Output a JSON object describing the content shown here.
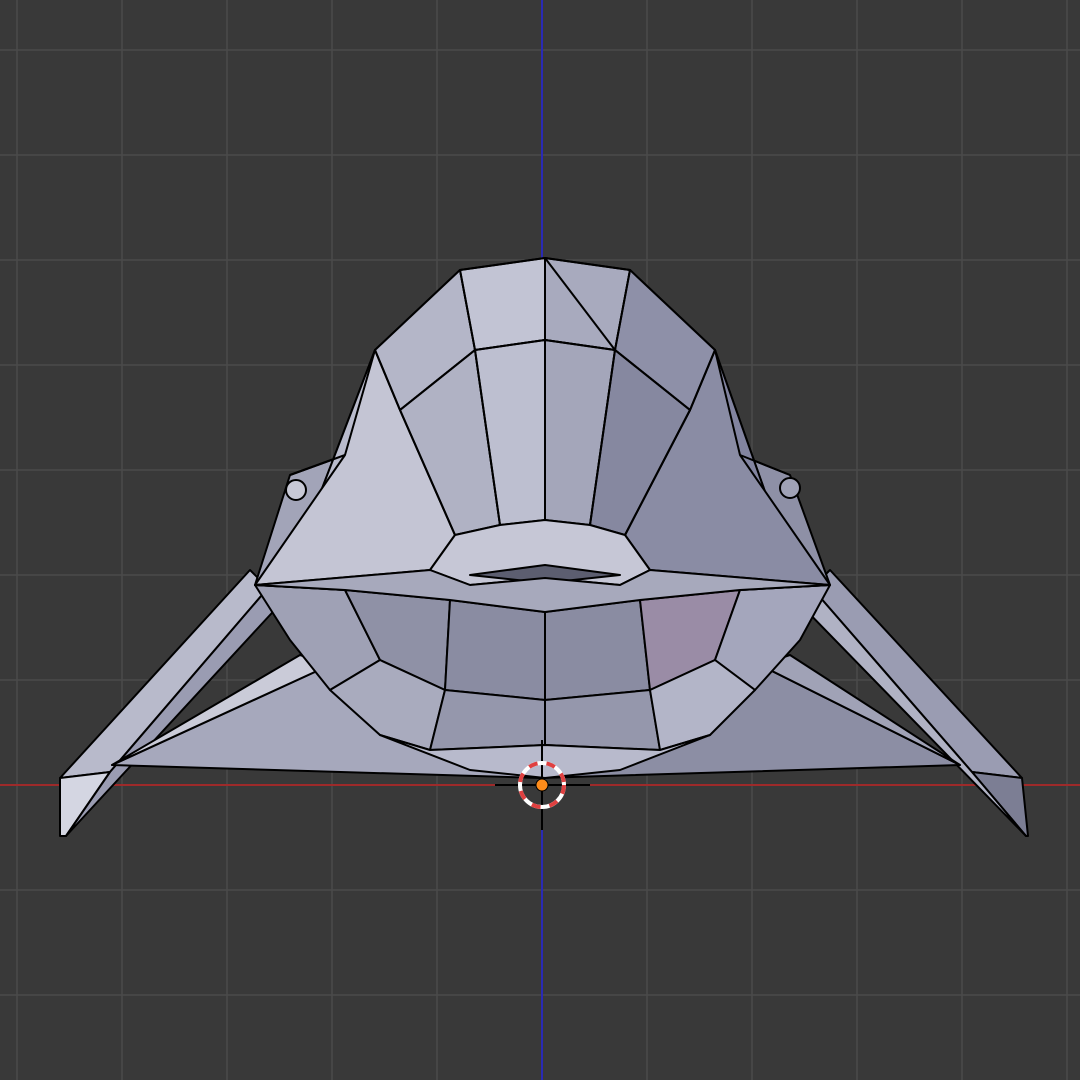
{
  "viewport": {
    "background": "#393939",
    "grid_color": "#4a4a4a",
    "x_axis_color": "#9e2a2a",
    "z_axis_color": "#2a2ab4"
  },
  "mesh": {
    "face_color_light": "#b4b6c8",
    "face_color_mid": "#9a9cb0",
    "face_color_dark": "#7c7e94",
    "edge_color": "#000000"
  },
  "cursor_3d": {
    "ring_color_a": "#e04040",
    "ring_color_b": "#ffffff"
  },
  "origin": {
    "color": "#ff8c1a"
  }
}
